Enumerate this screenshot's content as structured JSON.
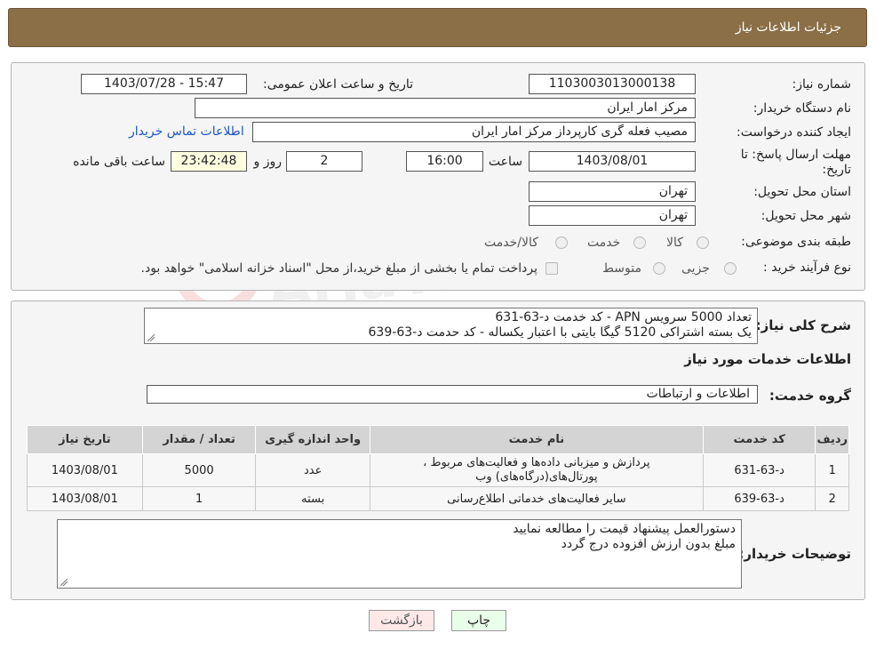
{
  "header": {
    "title": "جزئیات اطلاعات نیاز"
  },
  "form": {
    "need_number_label": "شماره نیاز:",
    "need_number": "1103003013000138",
    "announce_label": "تاریخ و ساعت اعلان عمومی:",
    "announce_value": "1403/07/28 - 15:47",
    "buyer_org_label": "نام دستگاه خریدار:",
    "buyer_org": "مرکز امار ایران",
    "creator_label": "ایجاد کننده درخواست:",
    "creator": "مصیب فعله گری کارپرداز مرکز امار ایران",
    "contact_link": "اطلاعات تماس خریدار",
    "deadline_label": "مهلت ارسال پاسخ: تا تاریخ:",
    "deadline_date": "1403/08/01",
    "time_label": "ساعت",
    "deadline_time": "16:00",
    "days_value": "2",
    "days_label": "روز و",
    "remaining_time": "23:42:48",
    "remaining_label": "ساعت باقی مانده",
    "province_label": "استان محل تحویل:",
    "province": "تهران",
    "city_label": "شهر محل تحویل:",
    "city": "تهران",
    "category_label": "طبقه بندی موضوعی:",
    "category_options": [
      "کالا",
      "خدمت",
      "کالا/خدمت"
    ],
    "category_selected": "خدمت",
    "process_label": "نوع فرآیند خرید :",
    "process_options": [
      "جزیی",
      "متوسط"
    ],
    "payment_note": "پرداخت تمام یا بخشی از مبلغ خرید،از محل \"اسناد خزانه اسلامی\" خواهد بود."
  },
  "summary": {
    "label": "شرح کلی نیاز:",
    "line1": "تعداد 5000 سرویس APN - کد خدمت د-63-631",
    "line2": "یک بسته اشتراکی 5120 گیگا بایتی با اعتبار یکساله  - کد حدمت د-63-639"
  },
  "services": {
    "section_title": "اطلاعات خدمات مورد نیاز",
    "group_label": "گروه خدمت:",
    "group_value": "اطلاعات و ارتباطات",
    "columns": [
      "ردیف",
      "کد خدمت",
      "نام خدمت",
      "واحد اندازه گیری",
      "تعداد / مقدار",
      "تاریخ نیاز"
    ],
    "rows": [
      {
        "idx": "1",
        "code": "د-63-631",
        "name1": "پردازش و میزبانی داده‌ها و فعالیت‌های مربوط ،",
        "name2": "پورتال‌های(درگاه‌های) وب",
        "unit": "عدد",
        "qty": "5000",
        "date": "1403/08/01"
      },
      {
        "idx": "2",
        "code": "د-63-639",
        "name1": "سایر فعالیت‌های خدماتی اطلاع‌رسانی",
        "name2": "",
        "unit": "بسته",
        "qty": "1",
        "date": "1403/08/01"
      }
    ]
  },
  "notes": {
    "label": "توضیحات خریدار:",
    "line1": "دستورالعمل پیشنهاد قیمت را مطالعه نمایید",
    "line2": "مبلغ بدون ارزش افزوده درج گردد"
  },
  "buttons": {
    "print": "چاپ",
    "back": "بازگشت"
  },
  "watermark": {
    "text": "AriaTender.neT"
  },
  "colors": {
    "header_bg": "#8b6f47",
    "link": "#1d56c7",
    "print_bg": "#eaffea",
    "back_bg": "#ffe8e8"
  }
}
